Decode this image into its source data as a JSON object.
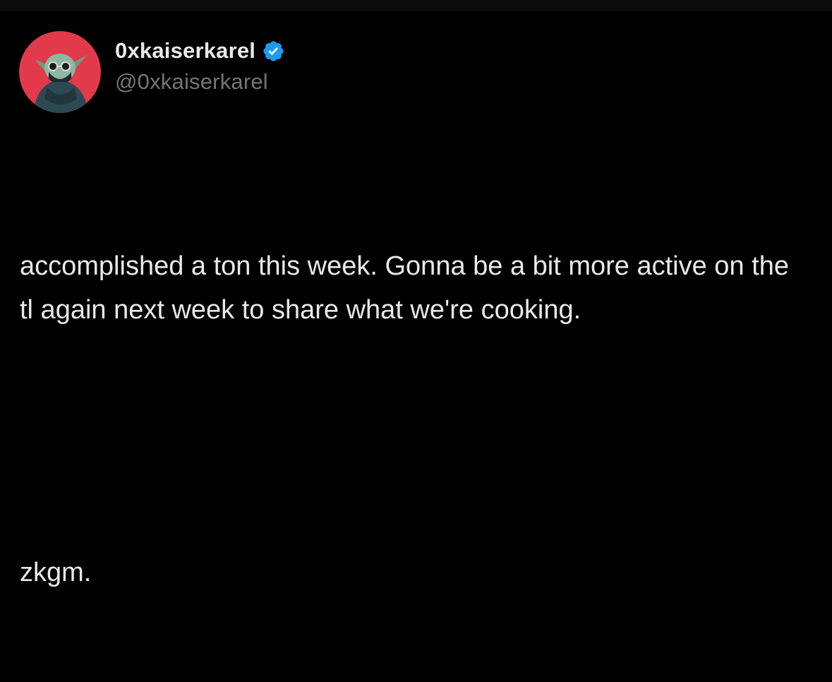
{
  "colors": {
    "background": "#000000",
    "text_primary": "#e7e9ea",
    "text_secondary": "#71767b",
    "verified_badge": "#1d9bf0",
    "avatar_background": "#e23a4a"
  },
  "author": {
    "display_name": "0xkaiserkarel",
    "handle": "@0xkaiserkarel",
    "verified": true,
    "verified_icon": "verified-badge-icon",
    "avatar_icon": "avatar-image"
  },
  "tweet": {
    "paragraphs": [
      "accomplished a ton this week. Gonna be a bit more active on the tl again next week to share what we're cooking.",
      "zkgm."
    ]
  }
}
